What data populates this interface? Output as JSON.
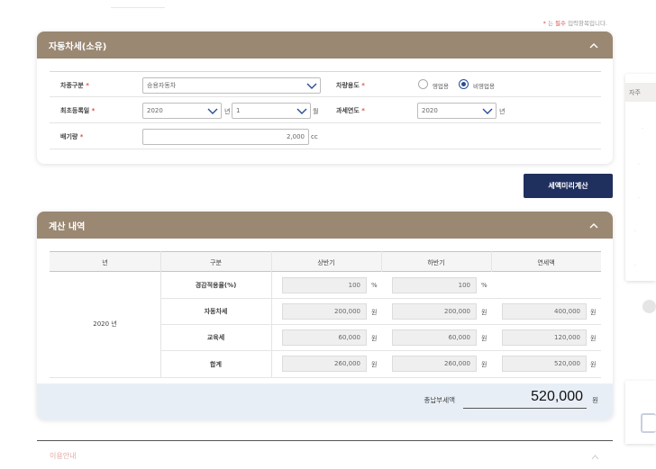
{
  "required_note": {
    "star": "*",
    "prefix": " 는 ",
    "em": "필수",
    "suffix": " 입력항목입니다."
  },
  "panel1": {
    "title": "자동차세(소유)",
    "vehicle_type": {
      "label": "차종구분",
      "value": "승용자동차"
    },
    "vehicle_use": {
      "label": "차량용도",
      "options": [
        "영업용",
        "비영업용"
      ],
      "selected": "비영업용"
    },
    "first_reg": {
      "label": "최초등록일",
      "year": "2020",
      "year_unit": "년",
      "month": "1",
      "month_unit": "월"
    },
    "tax_year": {
      "label": "과세연도",
      "value": "2020",
      "unit": "년"
    },
    "displacement": {
      "label": "배기량",
      "value": "2,000",
      "unit": "cc"
    }
  },
  "calc_button": "세액미리계산",
  "panel2": {
    "title": "계산 내역",
    "headers": [
      "년",
      "구분",
      "상반기",
      "하반기",
      "연세액"
    ],
    "year": "2020 년",
    "rows": [
      {
        "label": "경감적용율(%)",
        "h1": "100",
        "h2": "100",
        "annual": "",
        "unit": "%"
      },
      {
        "label": "자동차세",
        "h1": "200,000",
        "h2": "200,000",
        "annual": "400,000",
        "unit": "원"
      },
      {
        "label": "교육세",
        "h1": "60,000",
        "h2": "60,000",
        "annual": "120,000",
        "unit": "원"
      },
      {
        "label": "합계",
        "h1": "260,000",
        "h2": "260,000",
        "annual": "520,000",
        "unit": "원"
      }
    ],
    "total_label": "총납부세액",
    "total_value": "520,000",
    "total_unit": "원"
  },
  "bottom_section": {
    "title": "이용안내"
  },
  "side": {
    "title": "자주"
  }
}
